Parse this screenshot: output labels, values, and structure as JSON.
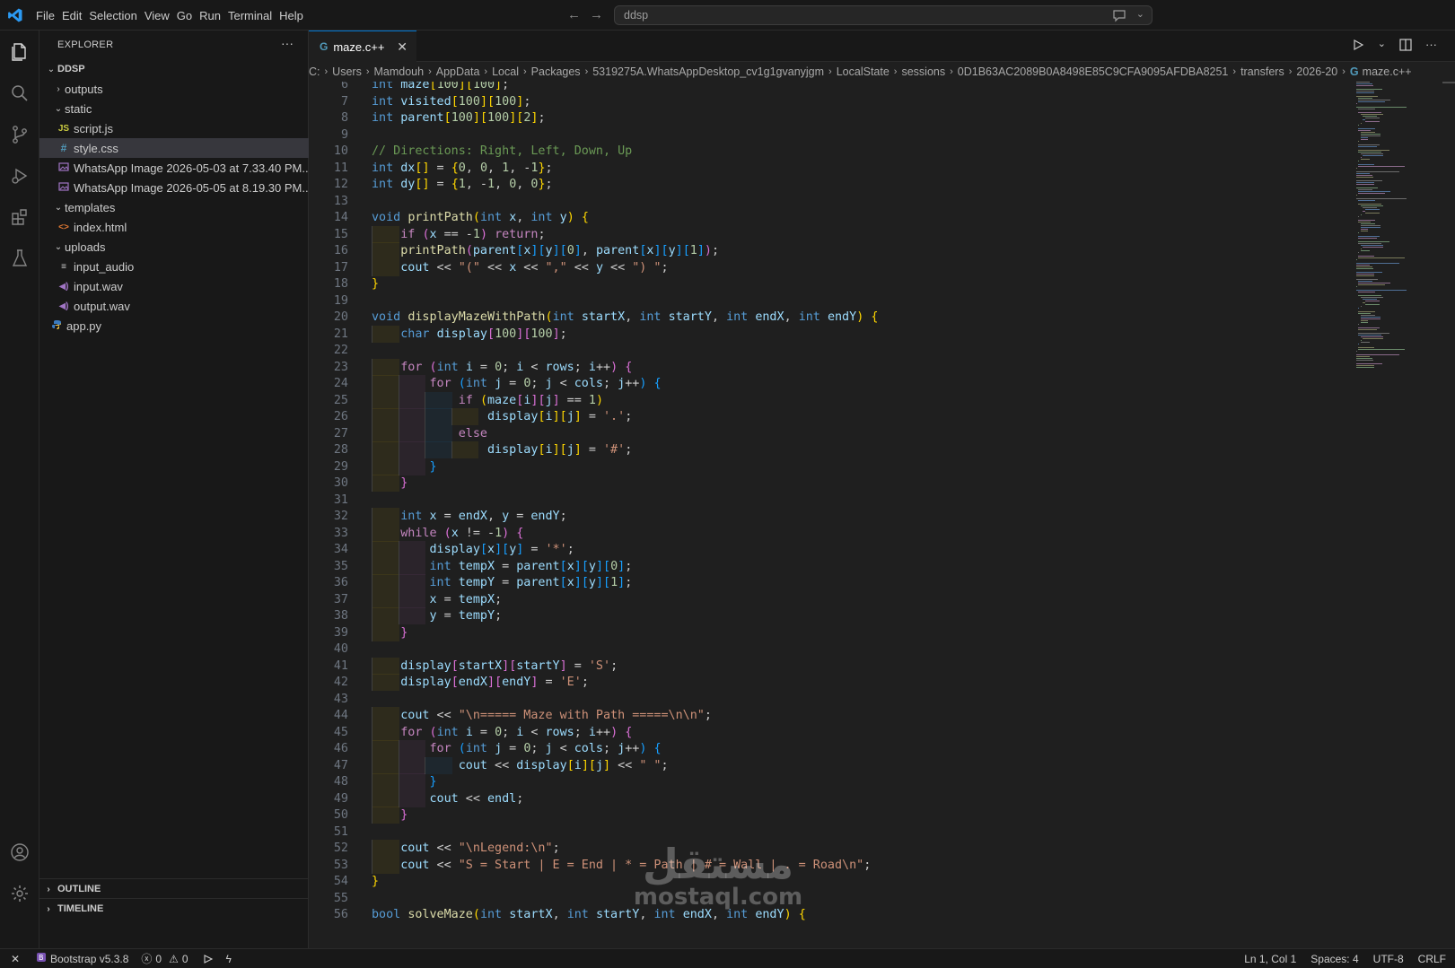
{
  "titlebar": {
    "menus": [
      "File",
      "Edit",
      "Selection",
      "View",
      "Go",
      "Run",
      "Terminal",
      "Help"
    ],
    "search_text": "ddsp"
  },
  "explorer": {
    "header": "EXPLORER",
    "root": "DDSP",
    "items": [
      {
        "label": "outputs",
        "kind": "folder",
        "expanded": false,
        "depth": 1
      },
      {
        "label": "static",
        "kind": "folder",
        "expanded": true,
        "depth": 1
      },
      {
        "label": "script.js",
        "kind": "js",
        "depth": 2,
        "badge": "JS"
      },
      {
        "label": "style.css",
        "kind": "css",
        "depth": 2,
        "badge": "#",
        "selected": true
      },
      {
        "label": "WhatsApp Image 2026-05-03 at 7.33.40 PM...",
        "kind": "image",
        "depth": 2
      },
      {
        "label": "WhatsApp Image 2026-05-05 at 8.19.30 PM...",
        "kind": "image",
        "depth": 2
      },
      {
        "label": "templates",
        "kind": "folder",
        "expanded": true,
        "depth": 1
      },
      {
        "label": "index.html",
        "kind": "html",
        "depth": 2,
        "badge": "<>"
      },
      {
        "label": "uploads",
        "kind": "folder",
        "expanded": true,
        "depth": 1
      },
      {
        "label": "input_audio",
        "kind": "text",
        "depth": 2
      },
      {
        "label": "input.wav",
        "kind": "audio",
        "depth": 2
      },
      {
        "label": "output.wav",
        "kind": "audio",
        "depth": 2
      },
      {
        "label": "app.py",
        "kind": "python",
        "depth": 1
      }
    ],
    "outline": "OUTLINE",
    "timeline": "TIMELINE"
  },
  "editor": {
    "tab": "maze.c++",
    "breadcrumb": [
      "C:",
      "Users",
      "Mamdouh",
      "AppData",
      "Local",
      "Packages",
      "5319275A.WhatsAppDesktop_cv1g1gvanyjgm",
      "LocalState",
      "sessions",
      "0D1B63AC2089B0A8498E85C9CFA9095AFDBA8251",
      "transfers",
      "2026-20",
      "maze.c++"
    ],
    "first_line": 6,
    "lines": [
      "int maze[100][100];",
      "int visited[100][100];",
      "int parent[100][100][2];",
      "",
      "// Directions: Right, Left, Down, Up",
      "int dx[] = {0, 0, 1, -1};",
      "int dy[] = {1, -1, 0, 0};",
      "",
      "void printPath(int x, int y) {",
      "    if (x == -1) return;",
      "    printPath(parent[x][y][0], parent[x][y][1]);",
      "    cout << \"(\" << x << \",\" << y << \") \";",
      "}",
      "",
      "void displayMazeWithPath(int startX, int startY, int endX, int endY) {",
      "    char display[100][100];",
      "",
      "    for (int i = 0; i < rows; i++) {",
      "        for (int j = 0; j < cols; j++) {",
      "            if (maze[i][j] == 1)",
      "                display[i][j] = '.';",
      "            else",
      "                display[i][j] = '#';",
      "        }",
      "    }",
      "",
      "    int x = endX, y = endY;",
      "    while (x != -1) {",
      "        display[x][y] = '*';",
      "        int tempX = parent[x][y][0];",
      "        int tempY = parent[x][y][1];",
      "        x = tempX;",
      "        y = tempY;",
      "    }",
      "",
      "    display[startX][startY] = 'S';",
      "    display[endX][endY] = 'E';",
      "",
      "    cout << \"\\n===== Maze with Path =====\\n\\n\";",
      "    for (int i = 0; i < rows; i++) {",
      "        for (int j = 0; j < cols; j++) {",
      "            cout << display[i][j] << \" \";",
      "        }",
      "        cout << endl;",
      "    }",
      "",
      "    cout << \"\\nLegend:\\n\";",
      "    cout << \"S = Start | E = End | * = Path | # = Wall | . = Road\\n\";",
      "}",
      "",
      "bool solveMaze(int startX, int startY, int endX, int endY) {"
    ]
  },
  "watermark": {
    "arabic": "مستقل",
    "latin": "mostaql.com"
  },
  "statusbar": {
    "bootstrap": "Bootstrap v5.3.8",
    "errors": "0",
    "warnings": "0",
    "position": "Ln 1, Col 1",
    "spaces": "Spaces: 4",
    "encoding": "UTF-8",
    "eol": "CRLF"
  },
  "colors": {
    "accent": "#0078d4",
    "keyword": "#569cd6",
    "control": "#c586c0",
    "function": "#dcdcaa",
    "number": "#b5cea8",
    "string": "#ce9178",
    "comment": "#6a9955"
  }
}
